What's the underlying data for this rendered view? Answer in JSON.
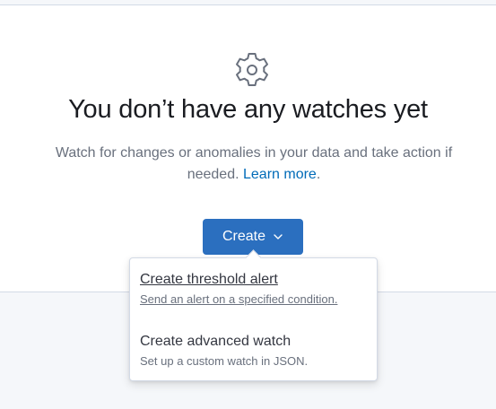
{
  "empty_state": {
    "icon": "gear-icon",
    "title": "You don’t have any watches yet",
    "description": "Watch for changes or anomalies in your data and take action if needed.",
    "learn_more": "Learn more",
    "period": "."
  },
  "create_button": {
    "label": "Create",
    "icon": "chevron-down-icon",
    "color": "#2b6fbf"
  },
  "menu": {
    "items": [
      {
        "label": "Create threshold alert",
        "description": "Send an alert on a specified condition."
      },
      {
        "label": "Create advanced watch",
        "description": "Set up a custom watch in JSON."
      }
    ]
  }
}
